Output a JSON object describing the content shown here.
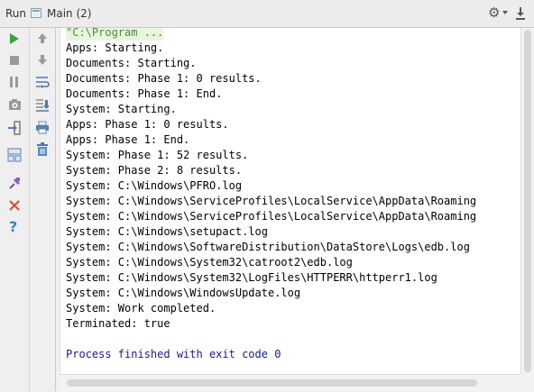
{
  "header": {
    "run_label": "Run",
    "tab_label": "Main (2)"
  },
  "console": {
    "command_line": "\"C:\\Program ...",
    "lines": [
      "Apps: Starting.",
      "Documents: Starting.",
      "Documents: Phase 1: 0 results.",
      "Documents: Phase 1: End.",
      "System: Starting.",
      "Apps: Phase 1: 0 results.",
      "Apps: Phase 1: End.",
      "System: Phase 1: 52 results.",
      "System: Phase 2: 8 results.",
      "System: C:\\Windows\\PFRO.log",
      "System: C:\\Windows\\ServiceProfiles\\LocalService\\AppData\\Roaming",
      "System: C:\\Windows\\ServiceProfiles\\LocalService\\AppData\\Roaming",
      "System: C:\\Windows\\setupact.log",
      "System: C:\\Windows\\SoftwareDistribution\\DataStore\\Logs\\edb.log",
      "System: C:\\Windows\\System32\\catroot2\\edb.log",
      "System: C:\\Windows\\System32\\LogFiles\\HTTPERR\\httperr1.log",
      "System: C:\\Windows\\WindowsUpdate.log",
      "System: Work completed.",
      "Terminated: true"
    ],
    "exit_line": "Process finished with exit code 0"
  },
  "icons": {
    "left_toolbar": [
      "run-icon",
      "stop-icon",
      "pause-icon",
      "camera-icon",
      "exit-icon",
      "layout-icon",
      "pin-icon",
      "close-icon",
      "help-icon"
    ],
    "right_toolbar": [
      "up-arrow-icon",
      "down-arrow-icon",
      "soft-wrap-icon",
      "scroll-to-end-icon",
      "print-icon",
      "trash-icon"
    ]
  }
}
